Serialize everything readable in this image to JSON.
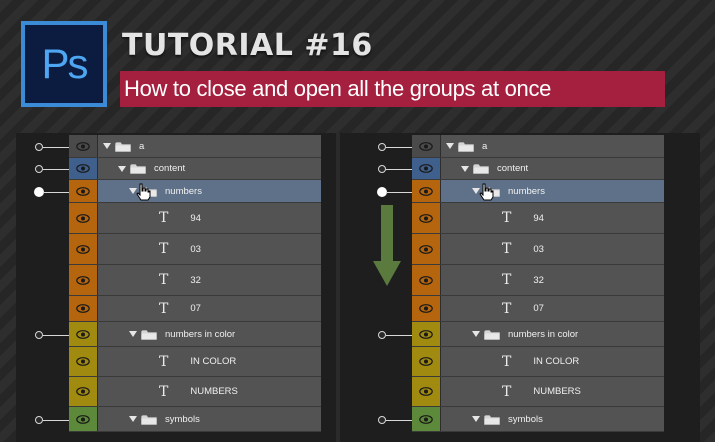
{
  "header": {
    "logo_text": "Ps",
    "title": "TUTORIAL #16",
    "subtitle": "How to close and open all the groups at once"
  },
  "colors": {
    "accent": "#a5203f",
    "selected_row": "#5f7189",
    "label_blue": "#3f5f8c",
    "label_orange": "#b5650d",
    "label_yellow": "#a08a10",
    "label_green": "#5d8a3a",
    "label_gray": "#4a4a4a"
  },
  "panels": {
    "left": {
      "layers": [
        {
          "name": "a",
          "kind": "group",
          "indent": 0,
          "eye_color": "gray"
        },
        {
          "name": "content",
          "kind": "group",
          "indent": 1,
          "eye_color": "blue"
        },
        {
          "name": "numbers",
          "kind": "group",
          "indent": 2,
          "eye_color": "orange",
          "selected": true
        },
        {
          "name": "94",
          "kind": "text",
          "indent": 3,
          "eye_color": "orange"
        },
        {
          "name": "03",
          "kind": "text",
          "indent": 3,
          "eye_color": "orange"
        },
        {
          "name": "32",
          "kind": "text",
          "indent": 3,
          "eye_color": "orange"
        },
        {
          "name": "07",
          "kind": "text",
          "indent": 3,
          "eye_color": "orange"
        },
        {
          "name": "numbers in color",
          "kind": "group",
          "indent": 2,
          "eye_color": "yellow"
        },
        {
          "name": "IN COLOR",
          "kind": "text",
          "indent": 3,
          "eye_color": "yellow"
        },
        {
          "name": "NUMBERS",
          "kind": "text",
          "indent": 3,
          "eye_color": "yellow"
        },
        {
          "name": "symbols",
          "kind": "group",
          "indent": 2,
          "eye_color": "green"
        }
      ]
    },
    "right": {
      "layers": [
        {
          "name": "a",
          "kind": "group",
          "indent": 0,
          "eye_color": "gray"
        },
        {
          "name": "content",
          "kind": "group",
          "indent": 1,
          "eye_color": "blue"
        },
        {
          "name": "numbers",
          "kind": "group",
          "indent": 2,
          "eye_color": "orange",
          "selected": true
        },
        {
          "name": "94",
          "kind": "text",
          "indent": 3,
          "eye_color": "orange"
        },
        {
          "name": "03",
          "kind": "text",
          "indent": 3,
          "eye_color": "orange"
        },
        {
          "name": "32",
          "kind": "text",
          "indent": 3,
          "eye_color": "orange"
        },
        {
          "name": "07",
          "kind": "text",
          "indent": 3,
          "eye_color": "orange"
        },
        {
          "name": "numbers in color",
          "kind": "group",
          "indent": 2,
          "eye_color": "yellow"
        },
        {
          "name": "IN COLOR",
          "kind": "text",
          "indent": 3,
          "eye_color": "yellow"
        },
        {
          "name": "NUMBERS",
          "kind": "text",
          "indent": 3,
          "eye_color": "yellow"
        },
        {
          "name": "symbols",
          "kind": "group",
          "indent": 2,
          "eye_color": "green"
        }
      ]
    }
  },
  "icons": {
    "visibility": "eye-icon",
    "group": "folder-icon",
    "text_layer": "type-layer-icon",
    "expand": "triangle-down-icon",
    "pointer": "hand-cursor-icon",
    "transition": "arrow-down-icon"
  }
}
